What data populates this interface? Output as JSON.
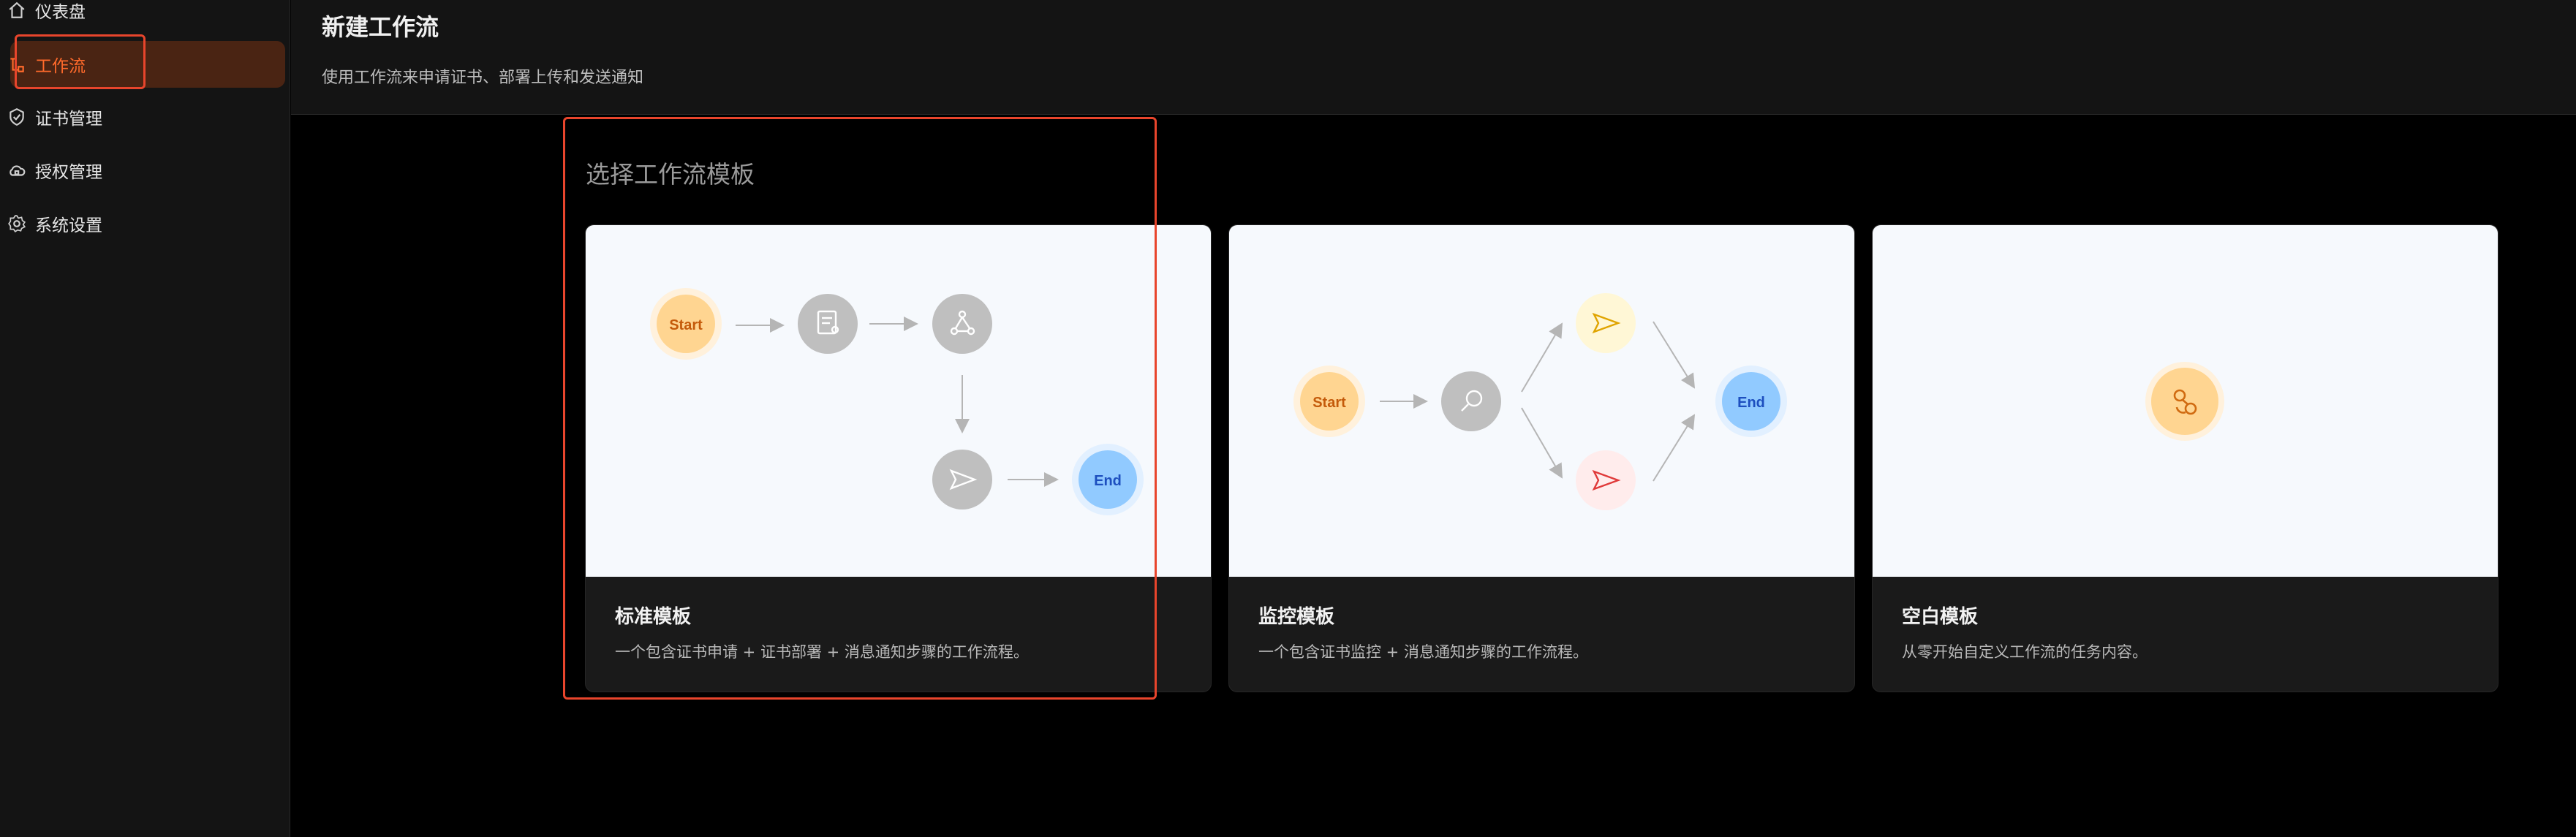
{
  "sidebar": {
    "items": [
      {
        "label": "仪表盘",
        "icon": "home-icon"
      },
      {
        "label": "工作流",
        "icon": "workflow-icon",
        "active": true
      },
      {
        "label": "证书管理",
        "icon": "shield-icon"
      },
      {
        "label": "授权管理",
        "icon": "cloud-lock-icon"
      },
      {
        "label": "系统设置",
        "icon": "gear-icon"
      }
    ]
  },
  "header": {
    "title": "新建工作流",
    "description": "使用工作流来申请证书、部署上传和发送通知"
  },
  "main": {
    "section_title": "选择工作流模板",
    "templates": [
      {
        "title": "标准模板",
        "description": "一个包含证书申请 + 证书部署 + 消息通知步骤的工作流程。"
      },
      {
        "title": "监控模板",
        "description": "一个包含证书监控 + 消息通知步骤的工作流程。"
      },
      {
        "title": "空白模板",
        "description": "从零开始自定义工作流的任务内容。"
      }
    ],
    "node_labels": {
      "start": "Start",
      "end": "End"
    }
  },
  "colors": {
    "accent": "#ff6a2b",
    "highlight": "#e8452c",
    "start_node": "#ffd591",
    "end_node": "#91caff",
    "step_node": "#bfbfbf"
  }
}
